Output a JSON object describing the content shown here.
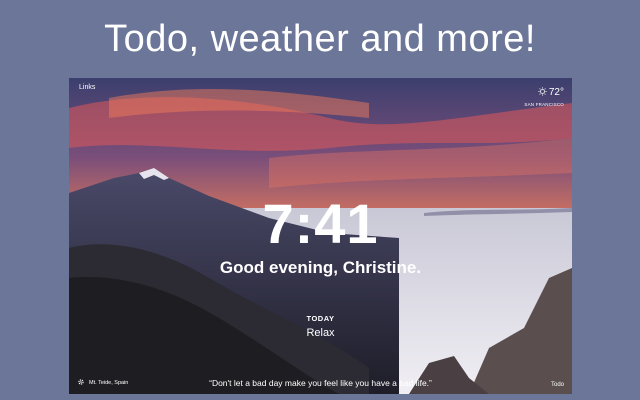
{
  "headline": "Todo, weather and more!",
  "screenshot": {
    "links_label": "Links",
    "weather": {
      "temperature": "72°",
      "city": "SAN FRANCISCO",
      "icon": "sun-icon"
    },
    "clock": "7:41",
    "greeting": "Good evening, Christine.",
    "focus": {
      "label": "TODAY",
      "text": "Relax"
    },
    "location": "Mt. Teide, Spain",
    "quote": "“Don't let a bad day make you feel like you have a bad life.”",
    "todo_label": "Todo"
  },
  "colors": {
    "page_background": "#6b7698",
    "text": "#ffffff"
  }
}
